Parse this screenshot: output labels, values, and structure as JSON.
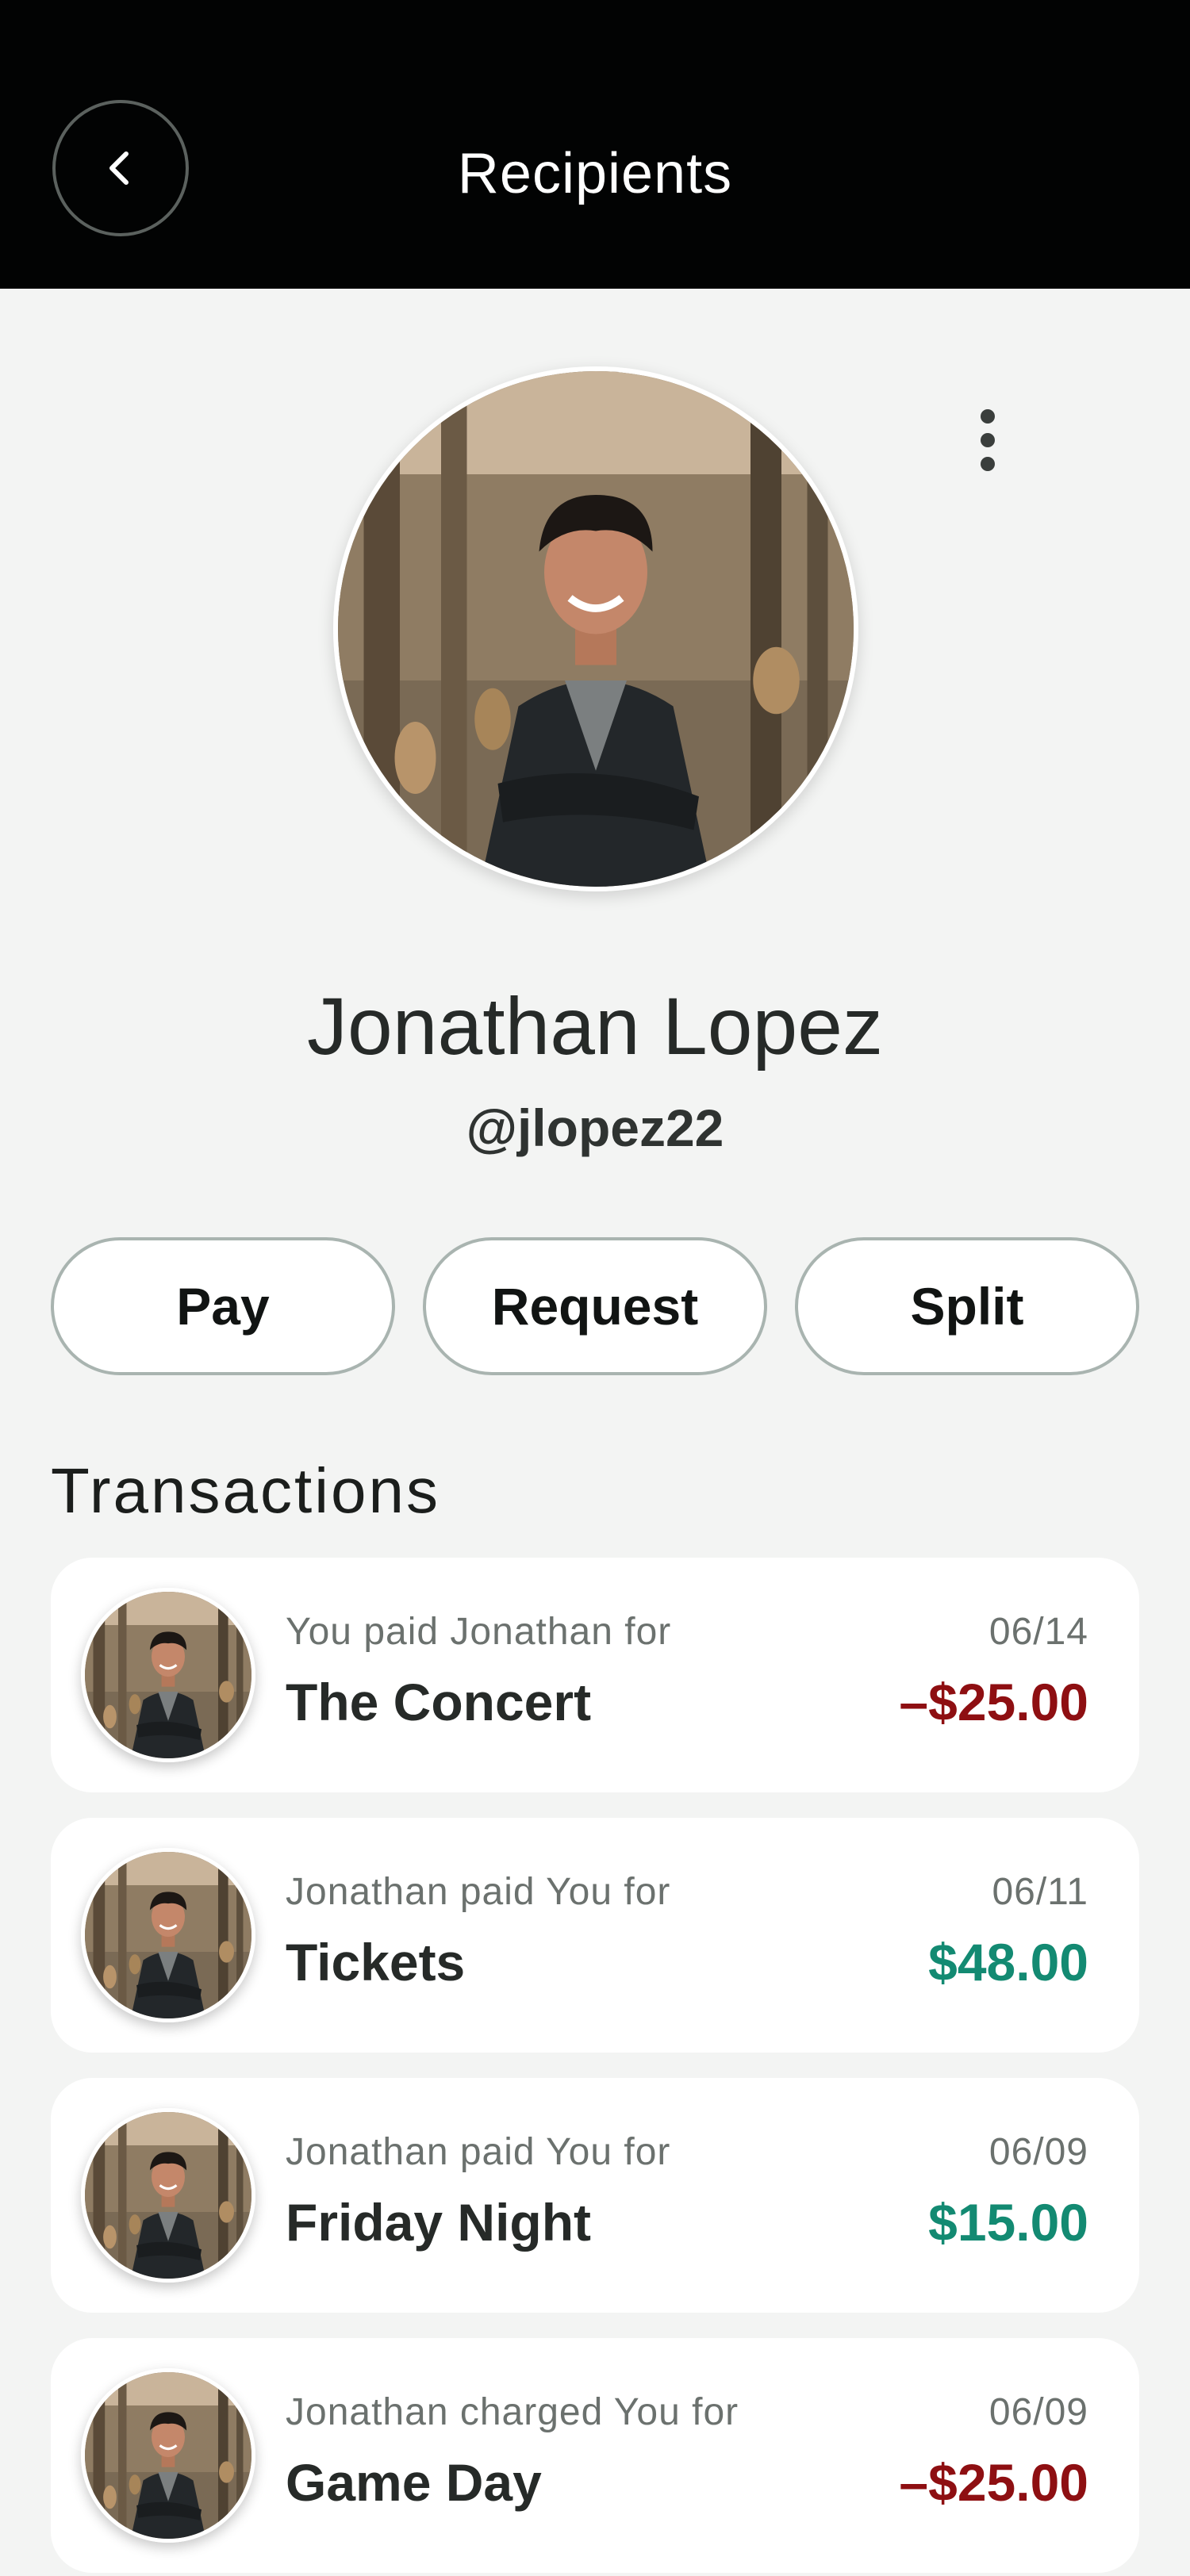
{
  "header": {
    "title": "Recipients",
    "back_icon": "chevron-left-icon"
  },
  "profile": {
    "name": "Jonathan Lopez",
    "handle": "@jlopez22",
    "menu_icon": "more-vertical-icon"
  },
  "actions": {
    "pay_label": "Pay",
    "request_label": "Request",
    "split_label": "Split"
  },
  "transactions": {
    "section_title": "Transactions",
    "items": [
      {
        "description": "You paid Jonathan for",
        "title": "The Concert",
        "date": "06/14",
        "amount": "–$25.00",
        "direction": "outgoing"
      },
      {
        "description": "Jonathan paid You for",
        "title": "Tickets",
        "date": "06/11",
        "amount": "$48.00",
        "direction": "incoming"
      },
      {
        "description": "Jonathan paid You for",
        "title": "Friday Night",
        "date": "06/09",
        "amount": "$15.00",
        "direction": "incoming"
      },
      {
        "description": "Jonathan charged You for",
        "title": "Game Day",
        "date": "06/09",
        "amount": "–$25.00",
        "direction": "outgoing"
      }
    ]
  },
  "colors": {
    "header_bg": "#020303",
    "page_bg": "#f3f4f3",
    "outgoing": "#8e0f12",
    "incoming": "#138a72"
  }
}
